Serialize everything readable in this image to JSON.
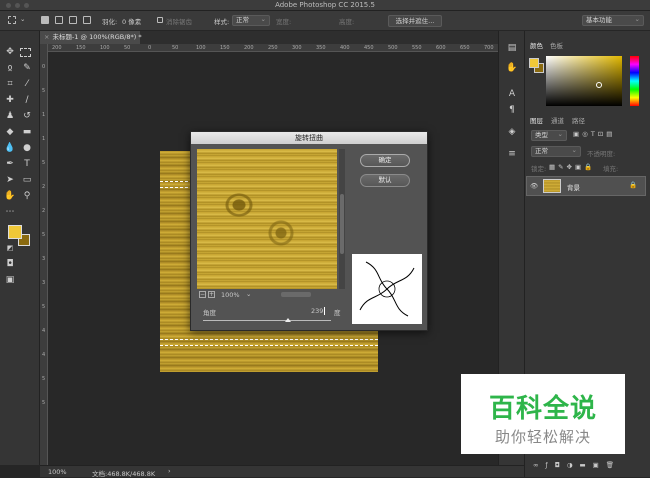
{
  "app": {
    "title": "Adobe Photoshop CC 2015.5"
  },
  "options_bar": {
    "feather_label": "羽化:",
    "feather_value": "0 像素",
    "antialias_label": "消除锯齿",
    "style_label": "样式:",
    "style_value": "正常",
    "width_label": "宽度:",
    "height_label": "高度:",
    "select_mask_button": "选择并遮住...",
    "workspace_value": "基本功能"
  },
  "document": {
    "tab_label": "未标题-1 @ 100%(RGB/8*) *"
  },
  "rulers": {
    "h_ticks": [
      "200",
      "150",
      "100",
      "50",
      "0",
      "50",
      "100",
      "150",
      "200",
      "250",
      "300",
      "350",
      "400",
      "450",
      "500",
      "550",
      "600",
      "650",
      "700"
    ],
    "v_ticks": [
      "0",
      "5",
      "1",
      "1",
      "5",
      "2",
      "2",
      "5",
      "3",
      "3",
      "5",
      "4",
      "4",
      "5",
      "5"
    ]
  },
  "dialog": {
    "title": "旋转扭曲",
    "ok_button": "确定",
    "reset_button": "默认",
    "zoom_value": "100%",
    "angle_label": "角度",
    "angle_value": "239",
    "angle_unit": "度"
  },
  "panels": {
    "color_tabs": [
      "颜色",
      "色板"
    ],
    "layer_tabs": [
      "图层",
      "通道",
      "路径"
    ],
    "kind_filter": "类型",
    "blend_mode": "正常",
    "opacity_label": "不透明度:",
    "lock_label": "锁定:",
    "fill_label": "填充:",
    "layer_name": "背景"
  },
  "status": {
    "zoom": "100%",
    "doc_size": "文档:468.8K/468.8K"
  },
  "watermark": {
    "main": "百科全说",
    "sub": "助你轻松解决"
  },
  "colors": {
    "foreground": "#f0c838",
    "background": "#8a6a10",
    "accent": "#2eb54a"
  }
}
